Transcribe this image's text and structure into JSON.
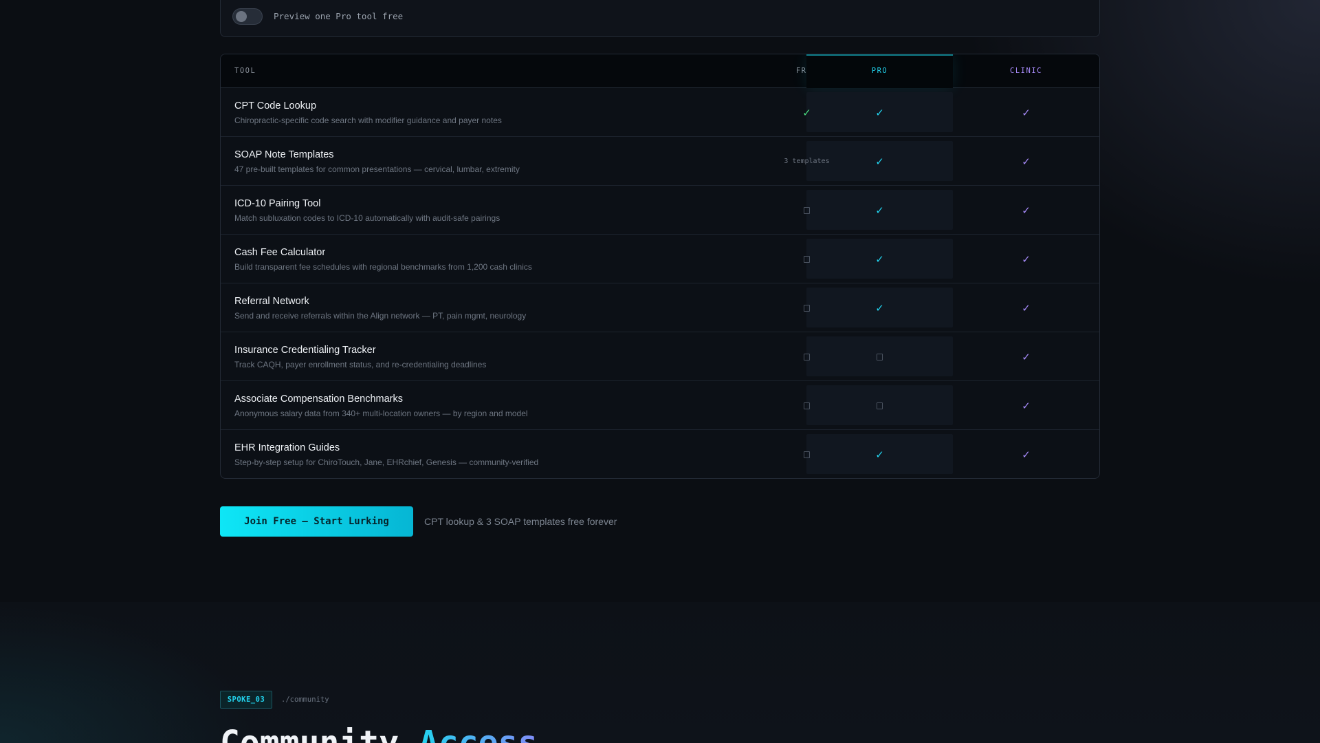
{
  "preview": {
    "label": "Preview one Pro tool free",
    "toggle_on": false
  },
  "table": {
    "headers": {
      "tool": "TOOL",
      "free": "FREE",
      "pro": "PRO",
      "clinic": "CLINIC"
    },
    "rows": [
      {
        "name": "CPT Code Lookup",
        "desc": "Chiropractic-specific code search with modifier guidance and payer notes",
        "free": "check",
        "pro": "check",
        "clinic": "check"
      },
      {
        "name": "SOAP Note Templates",
        "desc": "47 pre-built templates for common presentations — cervical, lumbar, extremity",
        "free": "3 templates",
        "pro": "check",
        "clinic": "check"
      },
      {
        "name": "ICD-10 Pairing Tool",
        "desc": "Match subluxation codes to ICD-10 automatically with audit-safe pairings",
        "free": "none",
        "pro": "check",
        "clinic": "check"
      },
      {
        "name": "Cash Fee Calculator",
        "desc": "Build transparent fee schedules with regional benchmarks from 1,200 cash clinics",
        "free": "none",
        "pro": "check",
        "clinic": "check"
      },
      {
        "name": "Referral Network",
        "desc": "Send and receive referrals within the Align network — PT, pain mgmt, neurology",
        "free": "none",
        "pro": "check",
        "clinic": "check"
      },
      {
        "name": "Insurance Credentialing Tracker",
        "desc": "Track CAQH, payer enrollment status, and re-credentialing deadlines",
        "free": "none",
        "pro": "none",
        "clinic": "check"
      },
      {
        "name": "Associate Compensation Benchmarks",
        "desc": "Anonymous salary data from 340+ multi-location owners — by region and model",
        "free": "none",
        "pro": "none",
        "clinic": "check"
      },
      {
        "name": "EHR Integration Guides",
        "desc": "Step-by-step setup for ChiroTouch, Jane, EHRchief, Genesis — community-verified",
        "free": "none",
        "pro": "check",
        "clinic": "check"
      }
    ],
    "check_glyph": "✓"
  },
  "cta": {
    "button_label": "Join Free — Start Lurking",
    "note": "CPT lookup & 3 SOAP templates free forever"
  },
  "community": {
    "badge": "SPOKE_03",
    "path": "./community",
    "heading_main": "Community ",
    "heading_accent": "Access"
  },
  "colors": {
    "accent_cyan": "#22d3ee",
    "free_check": "#4ade80",
    "clinic_check": "#a78bfa",
    "background": "#0b0e13"
  }
}
